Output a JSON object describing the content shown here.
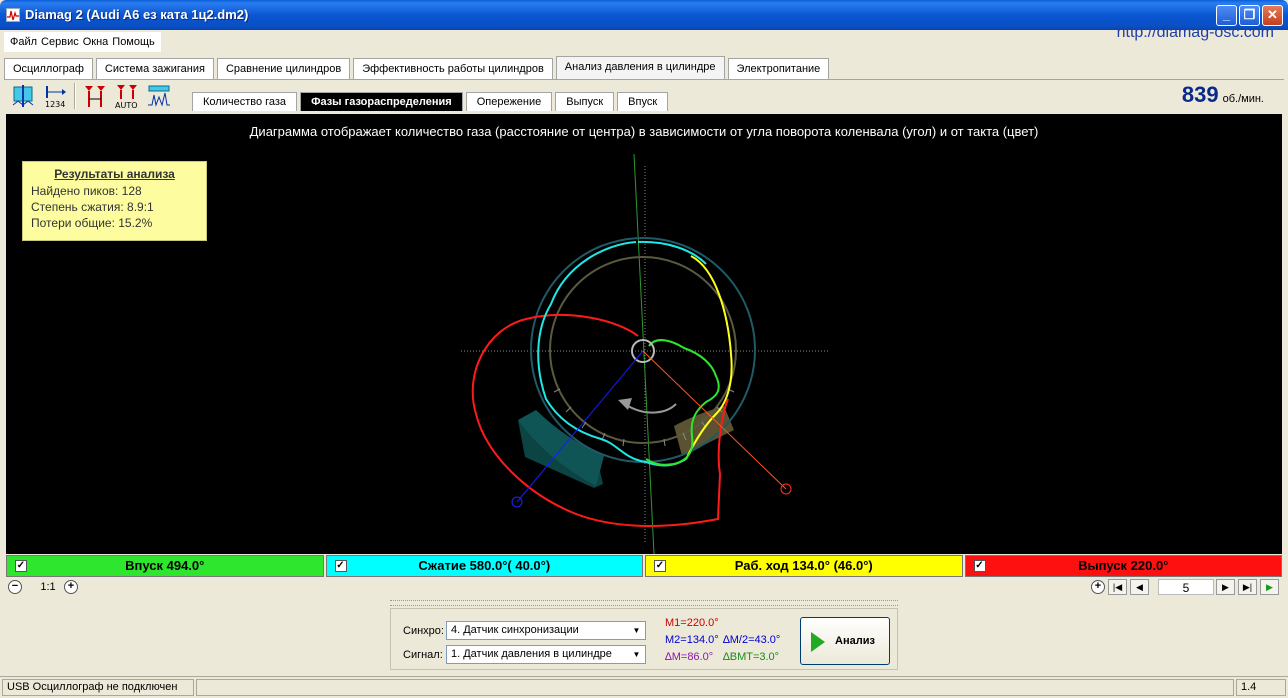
{
  "window": {
    "title": "Diamag 2 (Audi A6 ез ката 1ц2.dm2)",
    "url": "http://diamag-osc.com"
  },
  "menu": [
    "Файл",
    "Сервис",
    "Окна",
    "Помощь"
  ],
  "tabs": [
    "Осциллограф",
    "Система зажигания",
    "Сравнение цилиндров",
    "Эффективность работы цилиндров",
    "Анализ давления в цилиндре",
    "Электропитание"
  ],
  "active_tab": 4,
  "toolbar_icons": [
    "sync-marker-icon",
    "numbering-icon",
    "markers-icon",
    "auto-markers-icon",
    "filter-icon"
  ],
  "subtabs": [
    "Количество газа",
    "Фазы газораспределения",
    "Опережение",
    "Выпуск",
    "Впуск"
  ],
  "active_subtab": 1,
  "rpm": {
    "value": "839",
    "unit": "об./мин."
  },
  "diagram": {
    "caption": "Диаграмма отображает количество газа (расстояние от центра) в зависимости от угла поворота коленвала (угол) и от такта (цвет)",
    "results": {
      "title": "Результаты анализа",
      "peaks": "Найдено пиков: 128",
      "compression": "Степень сжатия: 8.9:1",
      "losses": "Потери общие: 15.2%"
    }
  },
  "phases": [
    {
      "label": "Впуск 494.0°",
      "color": "#2ee62e",
      "checked": true
    },
    {
      "label": "Сжатие 580.0°( 40.0°)",
      "color": "#00ffff",
      "checked": true
    },
    {
      "label": "Раб. ход 134.0° (46.0°)",
      "color": "#ffff00",
      "checked": true
    },
    {
      "label": "Выпуск 220.0°",
      "color": "#ff1010",
      "checked": true
    }
  ],
  "zoom": {
    "label": "1:1"
  },
  "navigation": {
    "value": "5"
  },
  "controls": {
    "sync_label": "Синхро:",
    "sync_value": "4.  Датчик синхронизации",
    "signal_label": "Сигнал:",
    "signal_value": "1.  Датчик давления в цилиндре",
    "m1": "M1=220.0°",
    "m2": "M2=134.0°",
    "dm2": "∆M/2=43.0°",
    "dm": "∆M=86.0°",
    "dbmt": "∆BMT=3.0°",
    "analyze_label": "Анализ"
  },
  "status": {
    "connection": "USB Осциллограф не подключен",
    "version": "1.4"
  }
}
